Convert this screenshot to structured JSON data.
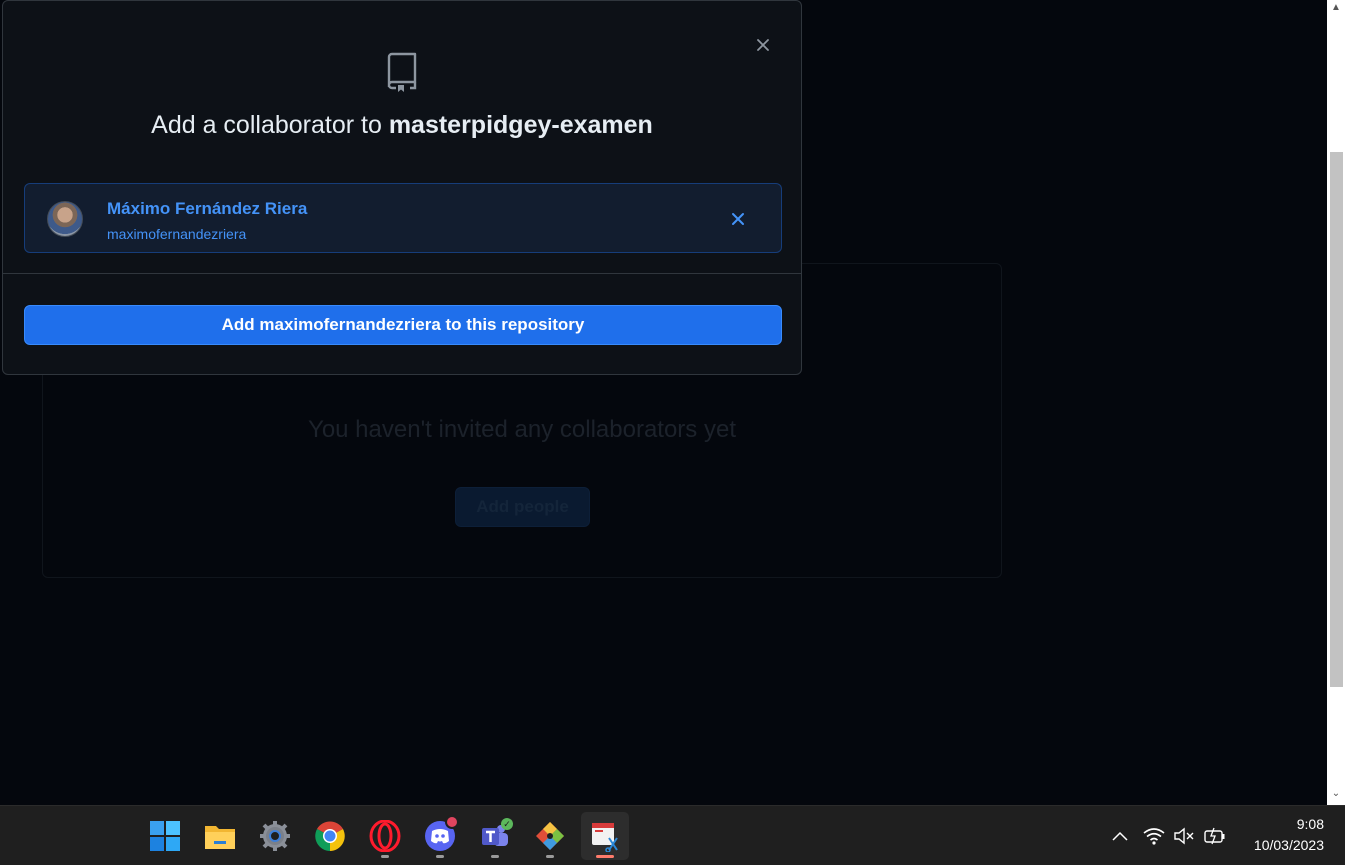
{
  "background": {
    "empty_title": "You haven't invited any collaborators yet",
    "add_people_label": "Add people"
  },
  "modal": {
    "title_prefix": "Add a collaborator to ",
    "repo_name": "masterpidgey-examen",
    "selected_user": {
      "name": "Máximo Fernández Riera",
      "login": "maximofernandezriera"
    },
    "confirm_label": "Add maximofernandezriera to this repository"
  },
  "taskbar": {
    "apps": [
      "start-icon",
      "file-explorer-icon",
      "settings-icon",
      "chrome-icon",
      "opera-icon",
      "discord-icon",
      "teams-icon",
      "git-icon",
      "snipping-tool-icon"
    ],
    "tray": [
      "show-hidden-icons-icon",
      "wifi-icon",
      "volume-muted-icon",
      "battery-icon"
    ],
    "time": "9:08",
    "date": "10/03/2023"
  },
  "colors": {
    "accent": "#1f6feb",
    "link": "#4493f8",
    "modal_bg": "#0d1117"
  }
}
